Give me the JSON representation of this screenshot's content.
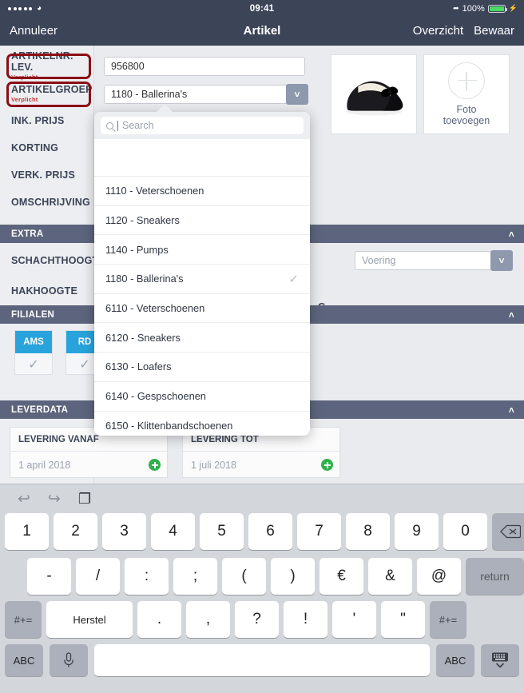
{
  "statusbar": {
    "time": "09:41",
    "battery_pct": "100%",
    "signal_dots": 5,
    "wifi_icon": "wifi-icon",
    "location_icon": "location-arrow-icon",
    "charging_icon": "charging-bolt-icon"
  },
  "navbar": {
    "cancel_label": "Annuleer",
    "title": "Artikel",
    "overview_label": "Overzicht",
    "save_label": "Bewaar"
  },
  "sidebar": {
    "required_note": "Verplicht",
    "items": [
      {
        "label": "ARTIKELNR. LEV.",
        "required": true
      },
      {
        "label": "ARTIKELGROEP",
        "required": true
      },
      {
        "label": "INK. PRIJS",
        "required": false
      },
      {
        "label": "KORTING",
        "required": false
      },
      {
        "label": "VERK. PRIJS",
        "required": false
      },
      {
        "label": "OMSCHRIJVING",
        "required": false
      }
    ],
    "extra_fields": [
      {
        "label": "SCHACHTHOOGTE"
      },
      {
        "label": "HAKHOOGTE"
      }
    ]
  },
  "sections": [
    {
      "id": "extra",
      "label": "EXTRA",
      "chevron": "chevron-up-icon"
    },
    {
      "id": "filialen",
      "label": "FILIALEN",
      "chevron": "chevron-up-icon"
    },
    {
      "id": "leverdata",
      "label": "LEVERDATA",
      "chevron": "chevron-up-icon"
    }
  ],
  "form": {
    "artikelnr_value": "956800",
    "artikelgroep_value": "1180 - Ballerina's",
    "artikelgroep_chevron": "chevron-down-icon",
    "voering_placeholder": "Voering",
    "voering_chevron": "chevron-down-icon",
    "partial_text": "G"
  },
  "photos": {
    "existing_alt": "ballerina-shoe-photo",
    "add_label_line1": "Foto",
    "add_label_line2": "toevoegen",
    "add_icon": "plus-circle-icon"
  },
  "filialen": {
    "branches": [
      {
        "code": "AMS",
        "checked": true
      },
      {
        "code": "RD",
        "checked": true
      }
    ],
    "check_icon": "check-icon"
  },
  "leverdata": {
    "cards": [
      {
        "title": "LEVERING VANAF",
        "value": "1 april 2018",
        "add_icon": "plus-circle-green-icon"
      },
      {
        "title": "LEVERING TOT",
        "value": "1 juli 2018",
        "add_icon": "plus-circle-green-icon"
      }
    ]
  },
  "popover": {
    "search_placeholder": "Search",
    "search_value": "",
    "search_icon": "search-icon",
    "check_icon": "check-icon",
    "options": [
      {
        "label": "",
        "selected": false,
        "blank": true
      },
      {
        "label": "1110 - Veterschoenen",
        "selected": false
      },
      {
        "label": "1120 - Sneakers",
        "selected": false
      },
      {
        "label": "1140 - Pumps",
        "selected": false
      },
      {
        "label": "1180 - Ballerina's",
        "selected": true
      },
      {
        "label": "6110 - Veterschoenen",
        "selected": false
      },
      {
        "label": "6120 - Sneakers",
        "selected": false
      },
      {
        "label": "6130 - Loafers",
        "selected": false
      },
      {
        "label": "6140 - Gespschoenen",
        "selected": false
      },
      {
        "label": "6150 - Klittenbandschoenen",
        "selected": false
      }
    ]
  },
  "keyboard": {
    "toolbar": [
      {
        "name": "undo-icon",
        "glyph": "↩"
      },
      {
        "name": "redo-icon",
        "glyph": "↪"
      },
      {
        "name": "paste-icon",
        "glyph": "❐"
      }
    ],
    "row1": [
      "1",
      "2",
      "3",
      "4",
      "5",
      "6",
      "7",
      "8",
      "9",
      "0"
    ],
    "backspace_icon": "backspace-icon",
    "row2": [
      "-",
      "/",
      ":",
      ";",
      "(",
      ")",
      "€",
      "&",
      "@"
    ],
    "return_label": "return",
    "row3_mod_left": "#+=",
    "row3_herstel": "Herstel",
    "row3": [
      ".",
      ",",
      "?",
      "!",
      "'",
      "\""
    ],
    "row3_mod_right": "#+=",
    "row4_abc_left": "ABC",
    "row4_mic_icon": "microphone-icon",
    "row4_space": "",
    "row4_abc_right": "ABC",
    "row4_hide_icon": "hide-keyboard-icon"
  },
  "colors": {
    "navbar": "#3c4458",
    "section_header": "#5c657d",
    "accent_blue": "#29a3dc",
    "required_red": "#c0392b",
    "highlight_red": "#8b0f14",
    "green": "#2fb14a"
  }
}
